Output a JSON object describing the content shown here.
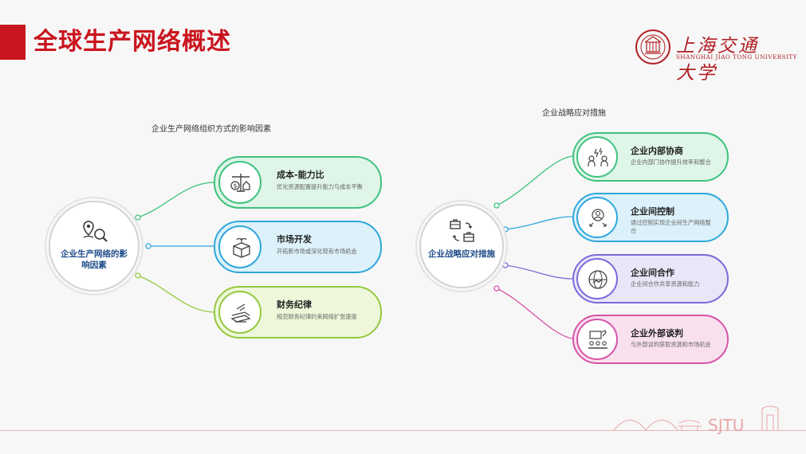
{
  "slide": {
    "title": "全球生产网络概述"
  },
  "logo": {
    "name_cn": "上海交通大学",
    "name_en": "SHANGHAI JIAO TONG UNIVERSITY",
    "footer_mark": "SJTU"
  },
  "colors": {
    "brand_red": "#c9151e",
    "green": "#3ec27d",
    "blue": "#2fa7dc",
    "lime": "#93c93f",
    "purple": "#7b69d8",
    "pink": "#d653a6"
  },
  "left": {
    "heading": "企业生产网络组织方式的影响因素",
    "hub_label": "企业生产网络的影响因素",
    "cards": [
      {
        "title": "成本-能力比",
        "desc": "优化资源配置提升能力与成本平衡",
        "icon": "balance-scale-icon"
      },
      {
        "title": "市场开发",
        "desc": "开拓新市场或深化现有市场机会",
        "icon": "box-growth-icon"
      },
      {
        "title": "财务纪律",
        "desc": "规范财务纪律约束网络扩张速度",
        "icon": "cash-stack-icon"
      }
    ]
  },
  "right": {
    "heading": "企业战略应对措施",
    "hub_label": "企业战略应对措施",
    "cards": [
      {
        "title": "企业内部协商",
        "desc": "企业内部门协作提升效率和整合",
        "icon": "team-collaboration-icon"
      },
      {
        "title": "企业间控制",
        "desc": "通过控制实现企业间生产网络整合",
        "icon": "controller-person-icon"
      },
      {
        "title": "企业间合作",
        "desc": "企业间合作共享资源和能力",
        "icon": "globe-handshake-icon"
      },
      {
        "title": "企业外部谈判",
        "desc": "与外部谈判获取资源和市场机会",
        "icon": "negotiation-table-icon"
      }
    ]
  }
}
